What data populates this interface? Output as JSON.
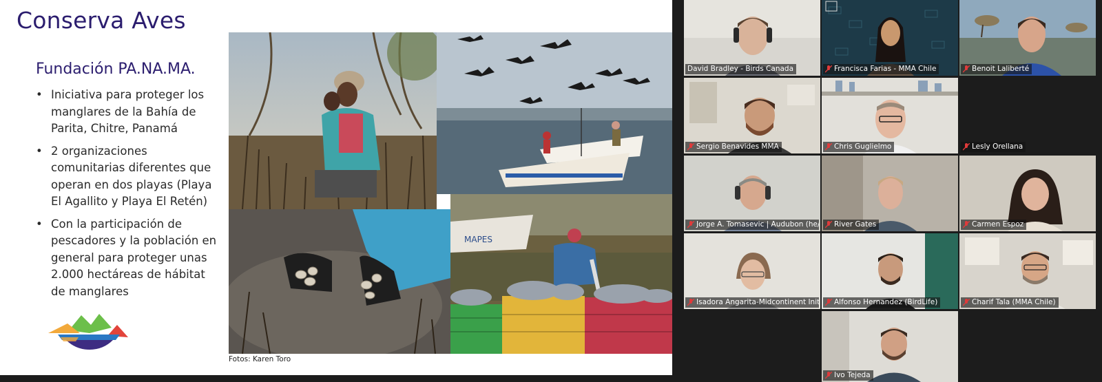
{
  "slide": {
    "title": "Conserva Aves",
    "subtitle": "Fundación PA.NA.MA.",
    "bullets": [
      "Iniciativa para proteger los manglares de la Bahía de Parita, Chitre, Panamá",
      "2 organizaciones comunitarias diferentes que operan en dos playas (Playa El Agallito y Playa El Retén)",
      "Con la participación de pescadores y la población en general para proteger unas 2.000 hectáreas de hábitat de manglares"
    ],
    "photo_credit": "Fotos: Karen Toro",
    "boat_text": "MAPES"
  },
  "participants": [
    {
      "name": "David Bradley - Birds Canada",
      "muted": false,
      "active": true
    },
    {
      "name": "Francisca Farias - MMA Chile",
      "muted": true,
      "active": false
    },
    {
      "name": "Benoit Laliberté",
      "muted": true,
      "active": false
    },
    {
      "name": "Sergio Benavides MMA",
      "muted": true,
      "active": false
    },
    {
      "name": "Chris Guglielmo",
      "muted": true,
      "active": false
    },
    {
      "name": "Lesly Orellana",
      "muted": true,
      "active": false
    },
    {
      "name": "Jorge A. Tomasevic | Audubon (he/...",
      "muted": true,
      "active": false
    },
    {
      "name": "River Gates",
      "muted": true,
      "active": false
    },
    {
      "name": "Carmen Espoz",
      "muted": true,
      "active": false
    },
    {
      "name": "Isadora Angarita-Midcontinent Initi...",
      "muted": true,
      "active": false
    },
    {
      "name": "Alfonso Hernandez (BirdLife)",
      "muted": true,
      "active": false
    },
    {
      "name": "Charif Tala (MMA Chile)",
      "muted": true,
      "active": false
    },
    {
      "name": "Ivo Tejeda",
      "muted": true,
      "active": false
    }
  ],
  "colors": {
    "title": "#2b1d6e",
    "active_speaker": "#2ecc71",
    "mute_icon": "#e03a3a"
  }
}
